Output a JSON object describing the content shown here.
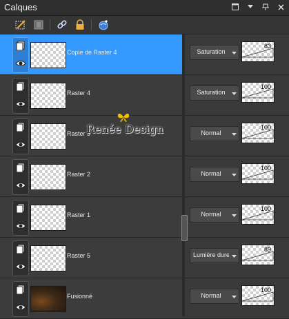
{
  "panel": {
    "title": "Calques"
  },
  "window_controls": [
    "maximize-icon",
    "dropdown-icon",
    "pin-icon",
    "close-icon"
  ],
  "toolbar": {
    "buttons": [
      "new-raster-icon",
      "mask-icon",
      "link-icon",
      "lock-icon",
      "globe-icon"
    ]
  },
  "layers": [
    {
      "name": "Copie de Raster 4",
      "blend": "Saturation",
      "opacity": "83",
      "selected": true,
      "thumb": "transparent"
    },
    {
      "name": "Raster 4",
      "blend": "Saturation",
      "opacity": "100",
      "selected": false,
      "thumb": "transparent"
    },
    {
      "name": "Raster 3",
      "blend": "Normal",
      "opacity": "100",
      "selected": false,
      "thumb": "transparent"
    },
    {
      "name": "Raster 2",
      "blend": "Normal",
      "opacity": "100",
      "selected": false,
      "thumb": "transparent"
    },
    {
      "name": "Raster 1",
      "blend": "Normal",
      "opacity": "100",
      "selected": false,
      "thumb": "transparent"
    },
    {
      "name": "Raster 5",
      "blend": "Lumière dure",
      "opacity": "89",
      "selected": false,
      "thumb": "transparent"
    },
    {
      "name": "Fusionné",
      "blend": "Normal",
      "opacity": "100",
      "selected": false,
      "thumb": "image"
    }
  ],
  "watermark": {
    "text": "Renée Design"
  },
  "colors": {
    "selected": "#3399ff",
    "panel_bg": "#3b3b3b",
    "butterfly": "#f2c200"
  }
}
